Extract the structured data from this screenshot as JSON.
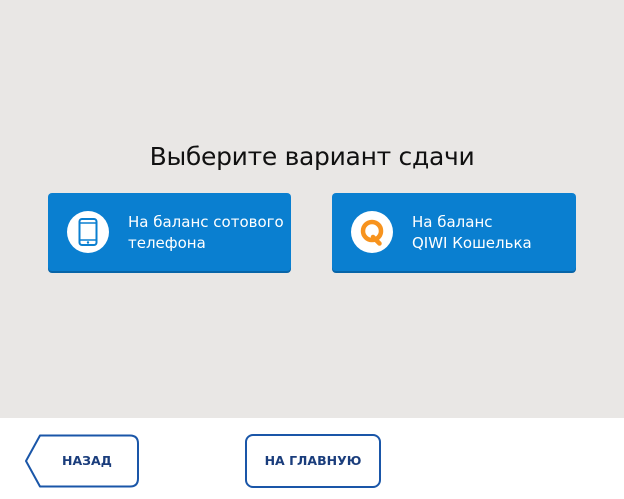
{
  "screen": {
    "title": "Выберите вариант сдачи"
  },
  "options": [
    {
      "line1": "На баланс сотового",
      "line2": "телефона",
      "icon": "mobile-phone-icon"
    },
    {
      "line1": "На баланс",
      "line2": "QIWI Кошелька",
      "icon": "qiwi-logo-icon"
    }
  ],
  "navigation": {
    "back_label": "НАЗАД",
    "home_label": "НА ГЛАВНУЮ"
  },
  "colors": {
    "background": "#e9e7e5",
    "button_blue": "#0a7fd0",
    "nav_border": "#1a56a8",
    "nav_text": "#1a3d7c",
    "qiwi_orange": "#f7931e"
  }
}
